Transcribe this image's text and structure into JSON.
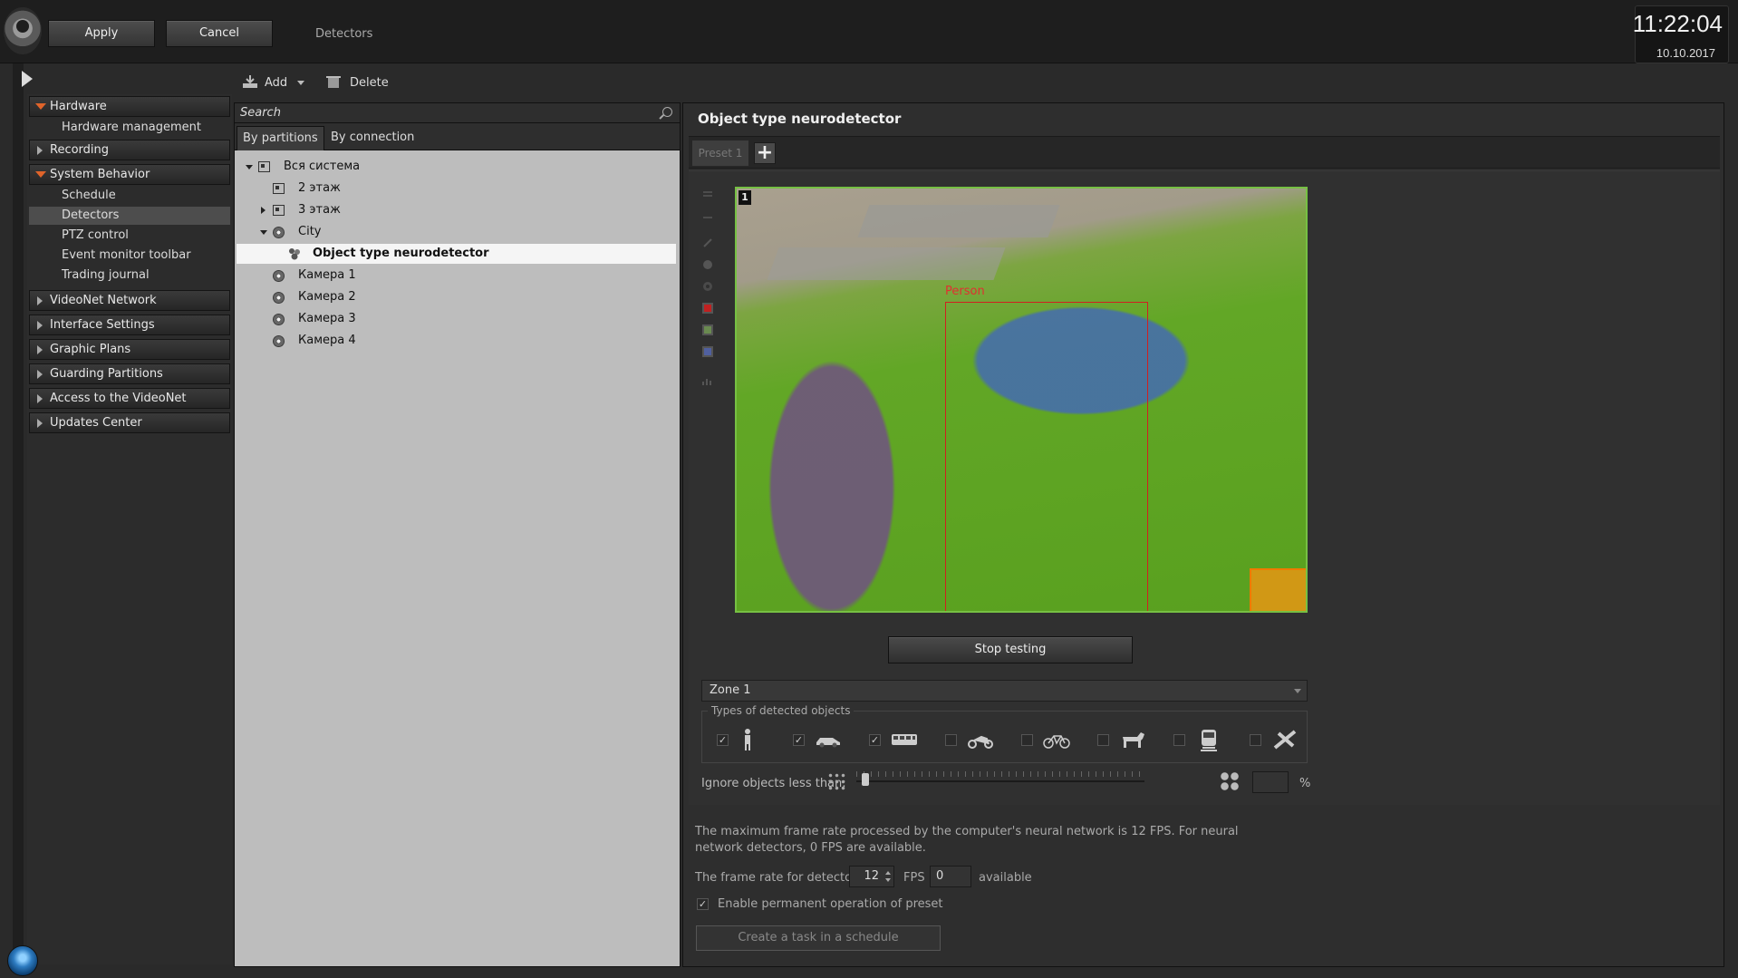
{
  "topbar": {
    "apply_label": "Apply",
    "cancel_label": "Cancel",
    "section_title": "Detectors",
    "clock_time": "11:22:04",
    "clock_date": "10.10.2017"
  },
  "toolbar": {
    "add_label": "Add",
    "delete_label": "Delete"
  },
  "nav": {
    "sections": [
      {
        "label": "Hardware",
        "open": true
      },
      {
        "label": "Recording",
        "open": false
      },
      {
        "label": "System Behavior",
        "open": true
      },
      {
        "label": "VideoNet Network",
        "open": false
      },
      {
        "label": "Interface Settings",
        "open": false
      },
      {
        "label": "Graphic Plans",
        "open": false
      },
      {
        "label": "Guarding Partitions",
        "open": false
      },
      {
        "label": "Access to the VideoNet",
        "open": false
      },
      {
        "label": "Updates Center",
        "open": false
      }
    ],
    "hardware_items": [
      "Hardware management"
    ],
    "behavior_items": [
      "Schedule",
      "Detectors",
      "PTZ control",
      "Event monitor toolbar",
      "Trading journal"
    ],
    "active_item": "Detectors"
  },
  "tree": {
    "search_placeholder": "Search",
    "tabs": [
      "By partitions",
      "By connection"
    ],
    "active_tab": "By partitions",
    "rows": [
      {
        "label": "Вся система",
        "icon": "partition-icon",
        "level": 0,
        "expander": "open"
      },
      {
        "label": "2 этаж",
        "icon": "partition-icon",
        "level": 1,
        "expander": "none"
      },
      {
        "label": "3 этаж",
        "icon": "partition-icon",
        "level": 1,
        "expander": "closed"
      },
      {
        "label": "City",
        "icon": "camera-icon",
        "level": 1,
        "expander": "open"
      },
      {
        "label": "Object type neurodetector",
        "icon": "detector-icon",
        "level": 2,
        "expander": "none",
        "selected": true
      },
      {
        "label": "Камера 1",
        "icon": "camera-icon",
        "level": 1,
        "expander": "none"
      },
      {
        "label": "Камера 2",
        "icon": "camera-icon",
        "level": 1,
        "expander": "none"
      },
      {
        "label": "Камера 3",
        "icon": "camera-icon",
        "level": 1,
        "expander": "none"
      },
      {
        "label": "Камера 4",
        "icon": "camera-icon",
        "level": 1,
        "expander": "none"
      }
    ]
  },
  "detector": {
    "title": "Object type neurodetector",
    "preset_tab": "Preset 1",
    "video_number": "1",
    "detection_label": "Person",
    "stop_button": "Stop testing",
    "zone_selected": "Zone 1",
    "types_legend": "Types of detected objects",
    "types": [
      {
        "name": "person",
        "icon": "person-icon",
        "checked": true
      },
      {
        "name": "car",
        "icon": "car-icon",
        "checked": true
      },
      {
        "name": "bus",
        "icon": "bus-icon",
        "checked": true
      },
      {
        "name": "motorcycle",
        "icon": "motorcycle-icon",
        "checked": false
      },
      {
        "name": "bicycle",
        "icon": "bicycle-icon",
        "checked": false
      },
      {
        "name": "animal",
        "icon": "dog-icon",
        "checked": false
      },
      {
        "name": "train",
        "icon": "train-icon",
        "checked": false
      },
      {
        "name": "airplane",
        "icon": "airplane-icon",
        "checked": false
      }
    ],
    "ignore_label": "Ignore objects less than:",
    "ignore_value": "",
    "ignore_unit": "%",
    "info_text": "The maximum frame rate processed by the computer's neural network is 12 FPS. For neural network detectors, 0 FPS are available.",
    "fps_label": "The frame rate for detector:",
    "fps_value": "12",
    "fps_unit": "FPS",
    "fps_available_value": "0",
    "available_label": "available",
    "permanent_label": "Enable permanent operation of preset",
    "permanent_checked": true,
    "task_button": "Create a task in a schedule"
  },
  "colors": {
    "accent_orange": "#e0642a",
    "zone_border": "#76c043",
    "detection_box": "#d02020"
  }
}
